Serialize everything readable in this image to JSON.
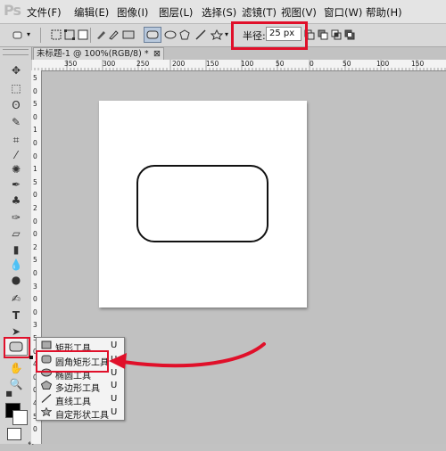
{
  "app": {
    "logo": "Ps"
  },
  "menu": [
    {
      "label": "文件(F)"
    },
    {
      "label": "编辑(E)"
    },
    {
      "label": "图像(I)"
    },
    {
      "label": "图层(L)"
    },
    {
      "label": "选择(S)"
    },
    {
      "label": "滤镜(T)"
    },
    {
      "label": "视图(V)"
    },
    {
      "label": "窗口(W)"
    },
    {
      "label": "帮助(H)"
    }
  ],
  "options": {
    "radius_label": "半径:",
    "radius_value": "25 px"
  },
  "document": {
    "tab_title": "未标题-1 @ 100%(RGB/8) *"
  },
  "ruler_top": [
    "350",
    "300",
    "250",
    "200",
    "150",
    "100",
    "50",
    "0",
    "50",
    "100",
    "150",
    "200",
    "250",
    "300",
    "350"
  ],
  "ruler_left": [
    "5",
    "0",
    "5",
    "0",
    "1",
    "0",
    "0",
    "1",
    "5",
    "0",
    "2",
    "0",
    "0",
    "2",
    "5",
    "0",
    "3",
    "0",
    "0",
    "3",
    "5",
    "0",
    "4",
    "0",
    "0",
    "4",
    "5",
    "0"
  ],
  "flyout": {
    "items": [
      {
        "label": "矩形工具",
        "key": "U",
        "icon": "rect-icon"
      },
      {
        "label": "圆角矩形工具",
        "key": "U",
        "icon": "rounded-rect-icon"
      },
      {
        "label": "椭圆工具",
        "key": "U",
        "icon": "ellipse-icon"
      },
      {
        "label": "多边形工具",
        "key": "U",
        "icon": "polygon-icon"
      },
      {
        "label": "直线工具",
        "key": "U",
        "icon": "line-icon"
      },
      {
        "label": "自定形状工具",
        "key": "U",
        "icon": "custom-shape-icon"
      }
    ]
  },
  "colors": {
    "highlight": "#e0102a",
    "foreground": "#000000",
    "background": "#ffffff"
  }
}
